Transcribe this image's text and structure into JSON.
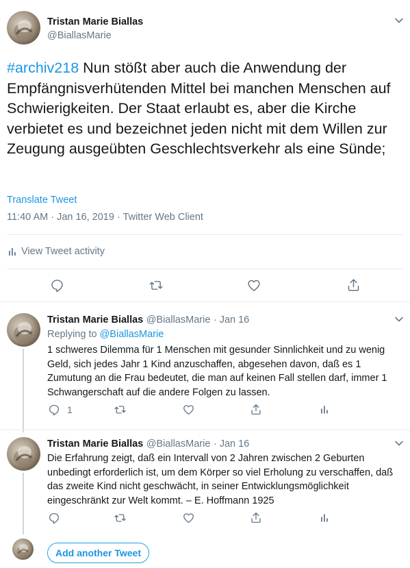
{
  "main_tweet": {
    "author_name": "Tristan Marie Biallas",
    "author_handle": "@BiallasMarie",
    "hashtag": "#archiv218",
    "text": " Nun stößt aber auch die Anwendung der Empfängnisverhütenden Mittel bei manchen Menschen auf Schwierigkeiten. Der Staat erlaubt es, aber die Kirche verbietet es und bezeichnet jeden nicht mit dem Willen zur Zeugung ausgeübten Geschlechtsverkehr als eine Sünde;",
    "translate_label": "Translate Tweet",
    "timestamp": "11:40 AM · Jan 16, 2019 · Twitter Web Client",
    "activity_label": "View Tweet activity"
  },
  "replies": [
    {
      "author_name": "Tristan Marie Biallas",
      "author_handle": "@BiallasMarie",
      "date": "· Jan 16",
      "replying_prefix": "Replying to ",
      "replying_to": "@BiallasMarie",
      "text": "1 schweres Dilemma für 1 Menschen mit gesunder  Sinnlichkeit und zu wenig Geld, sich jedes Jahr 1 Kind anzuschaffen,  abgesehen davon, daß es 1 Zumutung an die Frau bedeutet, die man auf  keinen Fall stellen darf, immer 1 Schwangerschaft auf die andere  Folgen zu lassen.",
      "reply_count": "1"
    },
    {
      "author_name": "Tristan Marie Biallas",
      "author_handle": "@BiallasMarie",
      "date": "· Jan 16",
      "text": "Die Erfahrung zeigt, daß ein Intervall von 2 Jahren zwischen 2 Geburten unbedingt erforderlich ist, um dem Körper so viel Erholung zu verschaffen, daß das zweite Kind nicht geschwächt, in seiner Entwicklungsmöglichkeit eingeschränkt zur Welt kommt. – E. Hoffmann 1925",
      "reply_count": ""
    }
  ],
  "compose": {
    "add_label": "Add another Tweet"
  },
  "colors": {
    "accent": "#1da1f2",
    "link": "#1b95e0",
    "secondary_text": "#657786",
    "border": "#e6ecf0"
  },
  "icons": [
    "chevron-down-icon",
    "reply-icon",
    "retweet-icon",
    "like-icon",
    "share-icon",
    "analytics-icon"
  ]
}
